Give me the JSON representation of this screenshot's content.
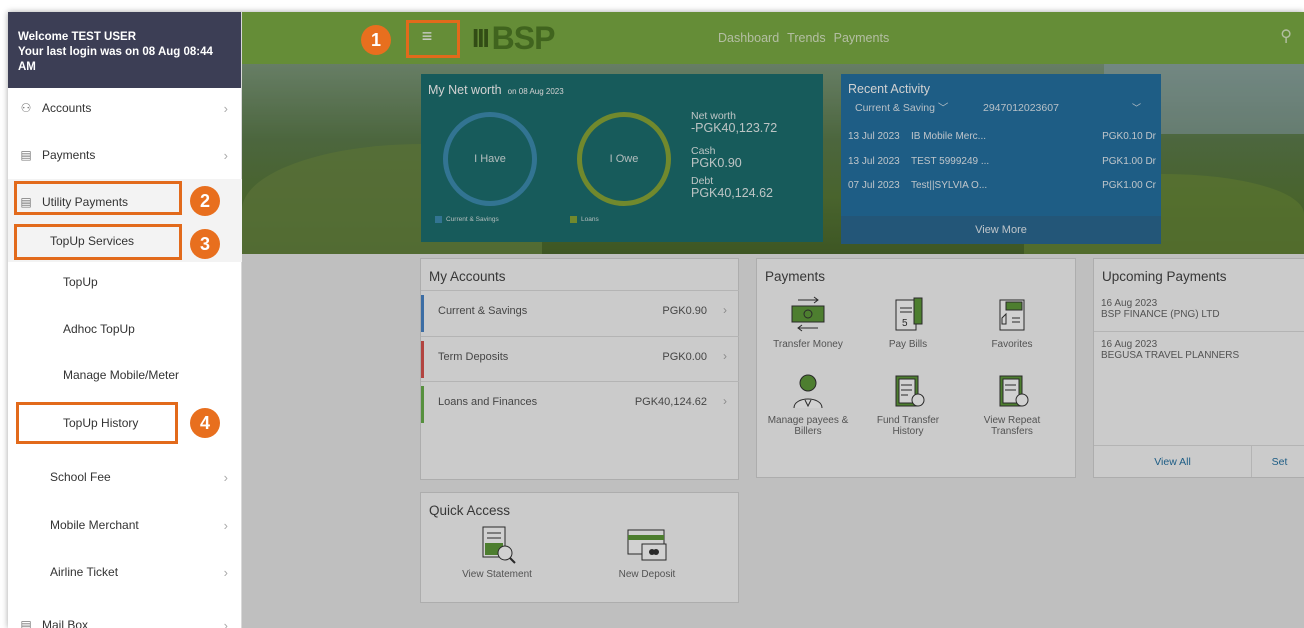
{
  "welcome": {
    "name_line": "Welcome TEST USER",
    "login_line": "Your last login was on 08 Aug 08:44 AM"
  },
  "sidebar": {
    "items": [
      {
        "label": "Accounts",
        "icon": "accounts-icon"
      },
      {
        "label": "Payments",
        "icon": "payments-icon"
      },
      {
        "label": "Utility Payments",
        "icon": "utility-payments-icon"
      },
      {
        "label": "TopUp Services"
      },
      {
        "label": "TopUp"
      },
      {
        "label": "Adhoc TopUp"
      },
      {
        "label": "Manage Mobile/Meter"
      },
      {
        "label": "TopUp History"
      },
      {
        "label": "School Fee"
      },
      {
        "label": "Mobile Merchant"
      },
      {
        "label": "Airline Ticket"
      },
      {
        "label": "Mail Box",
        "icon": "mailbox-icon"
      }
    ]
  },
  "header": {
    "logo_text": "BSP",
    "logo_mark": "III",
    "nav": [
      "Dashboard",
      "Trends",
      "Payments"
    ],
    "menu_glyph": "≡",
    "search_glyph": "🔍"
  },
  "networth": {
    "title": "My Net worth",
    "date": "on 08 Aug 2023",
    "have": "I Have",
    "owe": "I Owe",
    "legend_have": "Current & Savings",
    "legend_owe": "Loans",
    "networth_label": "Net worth",
    "networth_value": "-PGK40,123.72",
    "cash_label": "Cash",
    "cash_value": "PGK0.90",
    "debt_label": "Debt",
    "debt_value": "PGK40,124.62"
  },
  "recent": {
    "title": "Recent Activity",
    "account_type": "Current & Saving",
    "account_no": "2947012023607",
    "rows": [
      {
        "date": "13 Jul 2023",
        "name": "IB Mobile Merc...",
        "amount": "PGK0.10 Dr"
      },
      {
        "date": "13 Jul 2023",
        "name": "TEST 5999249 ...",
        "amount": "PGK1.00 Dr"
      },
      {
        "date": "07 Jul 2023",
        "name": "Test||SYLVIA O...",
        "amount": "PGK1.00 Cr"
      }
    ],
    "view_more": "View More"
  },
  "my_accounts": {
    "title": "My Accounts",
    "rows": [
      {
        "name": "Current & Savings",
        "value": "PGK0.90",
        "color": "#4a86c8"
      },
      {
        "name": "Term Deposits",
        "value": "PGK0.00",
        "color": "#d9534f"
      },
      {
        "name": "Loans and Finances",
        "value": "PGK40,124.62",
        "color": "#6ab04c"
      }
    ]
  },
  "payments": {
    "title": "Payments",
    "items": [
      {
        "label": "Transfer Money",
        "icon": "transfer-money-icon"
      },
      {
        "label": "Pay Bills",
        "icon": "pay-bills-icon"
      },
      {
        "label": "Favorites",
        "icon": "favorites-icon"
      },
      {
        "label": "Manage payees & Billers",
        "icon": "manage-payees-icon"
      },
      {
        "label": "Fund Transfer History",
        "icon": "fund-transfer-history-icon"
      },
      {
        "label": "View Repeat Transfers",
        "icon": "repeat-transfers-icon"
      }
    ]
  },
  "upcoming": {
    "title": "Upcoming Payments",
    "rows": [
      {
        "date": "16 Aug 2023",
        "name": "BSP FINANCE (PNG) LTD"
      },
      {
        "date": "16 Aug 2023",
        "name": "BEGUSA TRAVEL PLANNERS"
      }
    ],
    "view_all": "View All",
    "set": "Set"
  },
  "quick_access": {
    "title": "Quick Access",
    "items": [
      {
        "label": "View Statement",
        "icon": "view-statement-icon"
      },
      {
        "label": "New Deposit",
        "icon": "new-deposit-icon"
      }
    ]
  },
  "callouts": [
    "1",
    "2",
    "3",
    "4"
  ],
  "colors": {
    "topbar": "#7cac44",
    "networth_panel": "#1d6f6f",
    "recent_panel": "#2572a3",
    "callout": "#e86f1e",
    "welcome_bg": "#3c3e55"
  }
}
